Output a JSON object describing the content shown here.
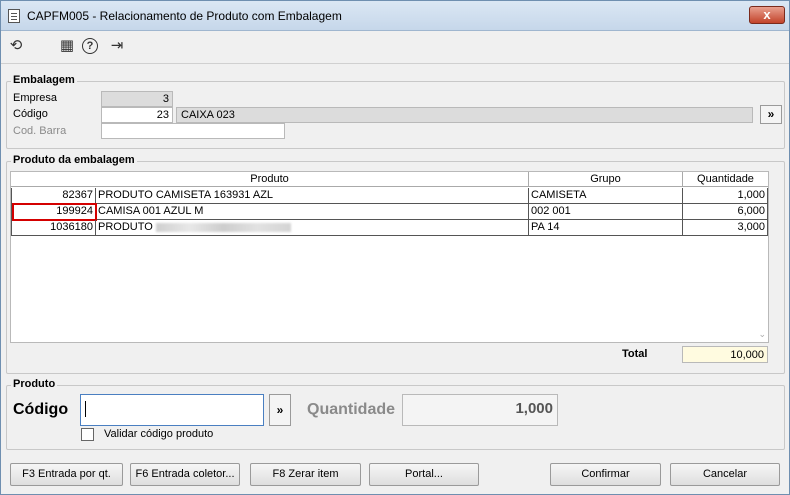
{
  "window": {
    "title": "CAPFM005 - Relacionamento de Produto com Embalagem",
    "close_label": "x"
  },
  "toolbar": {
    "icons": [
      "refresh-icon",
      "calendar-icon",
      "help-icon",
      "exit-icon"
    ],
    "refresh_glyph": "⟲",
    "calendar_glyph": "▦",
    "help_glyph": "?",
    "exit_glyph": "⇥"
  },
  "embalagem": {
    "legend": "Embalagem",
    "empresa_label": "Empresa",
    "empresa_value": "3",
    "codigo_label": "Código",
    "codigo_value": "23",
    "codigo_desc": "CAIXA 023",
    "lookup_label": "»",
    "cod_barra_label": "Cod. Barra",
    "cod_barra_value": ""
  },
  "produto_embalagem": {
    "legend": "Produto da embalagem",
    "columns": [
      "Produto",
      "Grupo",
      "Quantidade"
    ],
    "rows": [
      {
        "codigo": "82367",
        "produto": "PRODUTO CAMISETA 163931 AZL",
        "grupo": "CAMISETA",
        "quantidade": "1,000"
      },
      {
        "codigo": "199924",
        "produto": "CAMISA 001 AZUL M",
        "grupo": "002 001",
        "quantidade": "6,000"
      },
      {
        "codigo": "1036180",
        "produto": "PRODUTO",
        "grupo": "PA 14",
        "quantidade": "3,000"
      }
    ],
    "total_label": "Total",
    "total_value": "10,000"
  },
  "produto": {
    "legend": "Produto",
    "codigo_label": "Código",
    "codigo_value": "",
    "lookup_label": "»",
    "quantidade_label": "Quantidade",
    "quantidade_value": "1,000",
    "validar_label": "Validar código produto",
    "validar_checked": false
  },
  "buttons": {
    "f3": "F3 Entrada por qt.",
    "f6": "F6 Entrada coletor...",
    "f8": "F8 Zerar item",
    "portal": "Portal...",
    "confirmar": "Confirmar",
    "cancelar": "Cancelar"
  },
  "colors": {
    "highlight": "#d40000",
    "total_bg": "#fffbe0",
    "readonly_bg": "#dcdcdc"
  }
}
